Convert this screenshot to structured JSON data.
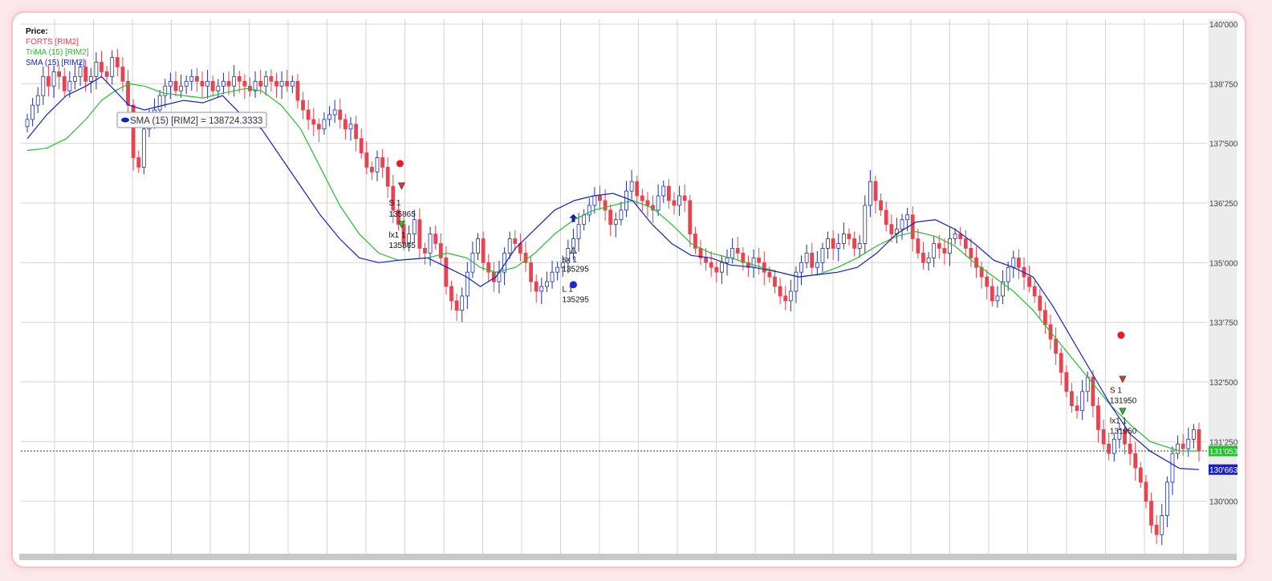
{
  "legend": {
    "heading": "Price:",
    "items": [
      {
        "label": "FORTS [RIM2]",
        "color": "#e8434f"
      },
      {
        "label": "TriMA (15) [RIM2]",
        "color": "#22c02a"
      },
      {
        "label": "SMA (15) [RIM2]",
        "color": "#1520c8"
      }
    ]
  },
  "tooltip": {
    "text": "SMA (15) [RIM2] = 138724.3333"
  },
  "price_tags": [
    {
      "text": "131'053",
      "value": 131053,
      "color": "#22c02a"
    },
    {
      "text": "130'663",
      "value": 130663,
      "color": "#1520c8"
    }
  ],
  "colors": {
    "up": "#1c2fb5",
    "down": "#e8434f",
    "sma": "#1520c8",
    "trima": "#22c02a",
    "grid": "#d4d4d4",
    "axis_panel": "#c8c8c8"
  },
  "chart_data": {
    "type": "line",
    "title": "",
    "y_axis": {
      "ticks": [
        130000,
        131250,
        132500,
        133750,
        135000,
        136250,
        137500,
        138750,
        140000
      ],
      "tick_labels": [
        "130'000",
        "131'250",
        "132'500",
        "133'750",
        "135'000",
        "136'250",
        "137'500",
        "138'750",
        "140'000"
      ],
      "ylim": [
        128900,
        140100
      ]
    },
    "grid": true,
    "last_price_line": 131053,
    "series": [
      {
        "name": "FORTS [RIM2]",
        "kind": "candlestick",
        "points": [
          138000,
          138300,
          138500,
          138900,
          138700,
          139000,
          138900,
          138600,
          138800,
          138900,
          139100,
          138800,
          138900,
          139200,
          139000,
          138900,
          139300,
          139100,
          138800,
          138300,
          137200,
          137000,
          137800,
          138000,
          138200,
          138500,
          138700,
          138800,
          138600,
          138700,
          138800,
          138900,
          138800,
          138700,
          138800,
          138600,
          138700,
          138800,
          138700,
          138900,
          138800,
          138700,
          138600,
          138800,
          138700,
          138900,
          138800,
          138700,
          138800,
          138700,
          138800,
          138400,
          138200,
          138000,
          137900,
          137800,
          138000,
          138100,
          138200,
          138000,
          137800,
          137900,
          137600,
          137300,
          137000,
          136900,
          137200,
          137000,
          136600,
          136100,
          135800,
          135400,
          135600,
          135900,
          135300,
          135200,
          135600,
          135400,
          135100,
          134500,
          134200,
          134000,
          134300,
          134800,
          135200,
          135500,
          135000,
          134800,
          134600,
          134800,
          135200,
          135500,
          135400,
          135200,
          135000,
          134600,
          134400,
          134500,
          134600,
          134800,
          134900,
          135000,
          135300,
          135500,
          135800,
          136000,
          136200,
          136400,
          136300,
          136100,
          135800,
          135900,
          136100,
          136500,
          136700,
          136400,
          136300,
          136200,
          136100,
          136400,
          136600,
          136300,
          136200,
          136400,
          136300,
          135600,
          135300,
          135100,
          135000,
          134900,
          134800,
          135000,
          135100,
          135300,
          135200,
          135000,
          134900,
          135100,
          135000,
          134800,
          134700,
          134500,
          134300,
          134200,
          134400,
          134800,
          135000,
          135200,
          134900,
          135000,
          135300,
          135500,
          135300,
          135400,
          135600,
          135500,
          135300,
          135400,
          136200,
          136700,
          136300,
          136100,
          135800,
          135600,
          135700,
          135900,
          136000,
          135500,
          135200,
          135000,
          135100,
          135400,
          135300,
          135200,
          135500,
          135600,
          135500,
          135300,
          135100,
          134900,
          134700,
          134500,
          134200,
          134300,
          134600,
          134900,
          135100,
          134900,
          134700,
          134500,
          134300,
          134000,
          133700,
          133400,
          133100,
          132700,
          132300,
          132000,
          131900,
          132300,
          132600,
          132000,
          131500,
          131200,
          131000,
          131300,
          131500,
          131200,
          131000,
          130700,
          130400,
          130000,
          129500,
          129300,
          129700,
          130400,
          131000,
          131200,
          131100,
          131300,
          131500,
          131053
        ]
      },
      {
        "name": "SMA (15) [RIM2]",
        "kind": "line",
        "points": [
          [
            0,
            137600
          ],
          [
            10,
            138100
          ],
          [
            20,
            138500
          ],
          [
            30,
            138700
          ],
          [
            38,
            138900
          ],
          [
            45,
            138600
          ],
          [
            52,
            138300
          ],
          [
            60,
            138200
          ],
          [
            70,
            138300
          ],
          [
            80,
            138400
          ],
          [
            90,
            138350
          ],
          [
            100,
            138500
          ],
          [
            112,
            138000
          ],
          [
            120,
            137800
          ],
          [
            130,
            137200
          ],
          [
            140,
            136600
          ],
          [
            150,
            136000
          ],
          [
            160,
            135500
          ],
          [
            170,
            135100
          ],
          [
            180,
            135000
          ],
          [
            190,
            135050
          ],
          [
            205,
            135100
          ],
          [
            215,
            134900
          ],
          [
            225,
            134700
          ],
          [
            232,
            134500
          ],
          [
            240,
            134700
          ],
          [
            250,
            135300
          ],
          [
            260,
            135700
          ],
          [
            270,
            136100
          ],
          [
            280,
            136300
          ],
          [
            290,
            136400
          ],
          [
            300,
            136450
          ],
          [
            310,
            136300
          ],
          [
            320,
            135800
          ],
          [
            330,
            135400
          ],
          [
            340,
            135150
          ],
          [
            350,
            135100
          ],
          [
            360,
            134950
          ],
          [
            372,
            134900
          ],
          [
            385,
            134800
          ],
          [
            395,
            134700
          ],
          [
            405,
            134750
          ],
          [
            415,
            134800
          ],
          [
            425,
            134900
          ],
          [
            435,
            135200
          ],
          [
            445,
            135600
          ],
          [
            455,
            135850
          ],
          [
            465,
            135900
          ],
          [
            475,
            135700
          ],
          [
            485,
            135400
          ],
          [
            495,
            135050
          ],
          [
            505,
            134900
          ],
          [
            515,
            134700
          ],
          [
            525,
            134100
          ],
          [
            535,
            133400
          ],
          [
            545,
            132700
          ],
          [
            555,
            132000
          ],
          [
            565,
            131400
          ],
          [
            575,
            131050
          ],
          [
            590,
            130690
          ],
          [
            600,
            130663
          ]
        ]
      },
      {
        "name": "TriMA (15) [RIM2]",
        "kind": "line",
        "points": [
          [
            0,
            137350
          ],
          [
            10,
            137400
          ],
          [
            20,
            137600
          ],
          [
            30,
            138000
          ],
          [
            38,
            138400
          ],
          [
            45,
            138600
          ],
          [
            52,
            138750
          ],
          [
            60,
            138700
          ],
          [
            70,
            138550
          ],
          [
            80,
            138500
          ],
          [
            90,
            138450
          ],
          [
            100,
            138550
          ],
          [
            112,
            138650
          ],
          [
            120,
            138600
          ],
          [
            130,
            138300
          ],
          [
            140,
            137800
          ],
          [
            150,
            137000
          ],
          [
            160,
            136200
          ],
          [
            170,
            135600
          ],
          [
            180,
            135200
          ],
          [
            190,
            135050
          ],
          [
            205,
            135100
          ],
          [
            215,
            135200
          ],
          [
            225,
            135100
          ],
          [
            232,
            134900
          ],
          [
            240,
            134800
          ],
          [
            250,
            134900
          ],
          [
            260,
            135200
          ],
          [
            270,
            135600
          ],
          [
            280,
            135900
          ],
          [
            290,
            136100
          ],
          [
            300,
            136200
          ],
          [
            310,
            136300
          ],
          [
            320,
            136150
          ],
          [
            330,
            135800
          ],
          [
            340,
            135400
          ],
          [
            350,
            135200
          ],
          [
            360,
            135100
          ],
          [
            372,
            134950
          ],
          [
            385,
            134800
          ],
          [
            395,
            134700
          ],
          [
            405,
            134750
          ],
          [
            415,
            134900
          ],
          [
            425,
            135100
          ],
          [
            435,
            135350
          ],
          [
            445,
            135550
          ],
          [
            455,
            135650
          ],
          [
            465,
            135550
          ],
          [
            475,
            135350
          ],
          [
            485,
            135000
          ],
          [
            495,
            134700
          ],
          [
            505,
            134400
          ],
          [
            515,
            134000
          ],
          [
            525,
            133500
          ],
          [
            535,
            133000
          ],
          [
            545,
            132500
          ],
          [
            555,
            132000
          ],
          [
            565,
            131600
          ],
          [
            575,
            131250
          ],
          [
            590,
            131053
          ],
          [
            600,
            131053
          ]
        ]
      }
    ],
    "annotations": [
      {
        "text": "S 1",
        "value": 135865
      },
      {
        "text": "135865",
        "value": 135865
      },
      {
        "text": "lx1 1",
        "value": 135865
      },
      {
        "text": "135865",
        "value": 135865
      },
      {
        "text": "sx 1",
        "value": 135295
      },
      {
        "text": "135295",
        "value": 135295
      },
      {
        "text": "L 1",
        "value": 135295
      },
      {
        "text": "135295",
        "value": 135295
      },
      {
        "text": "S 1",
        "value": 131950
      },
      {
        "text": "131950",
        "value": 131950
      },
      {
        "text": "lx1 1",
        "value": 131950
      },
      {
        "text": "131950",
        "value": 131950
      }
    ]
  }
}
